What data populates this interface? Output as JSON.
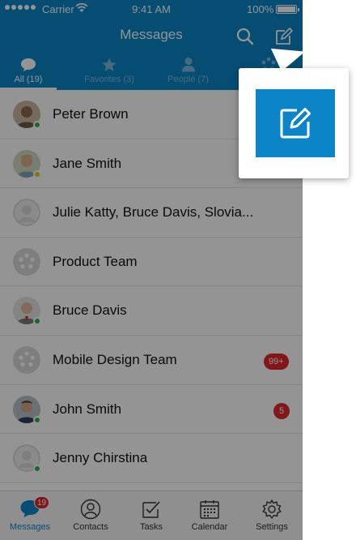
{
  "status_bar": {
    "carrier": "Carrier",
    "time": "9:41 AM",
    "battery": "100%"
  },
  "header": {
    "title": "Messages",
    "search_icon": "search-icon",
    "compose_icon": "compose-icon"
  },
  "tabs": [
    {
      "label": "All (19)",
      "icon": "chat-bubble-icon",
      "active": true
    },
    {
      "label": "Favorites (3)",
      "icon": "star-icon",
      "active": false
    },
    {
      "label": "People (7)",
      "icon": "person-icon",
      "active": false
    },
    {
      "label": "",
      "icon": "team-icon",
      "active": false
    }
  ],
  "conversations": [
    {
      "name": "Peter Brown",
      "avatar": "photo",
      "presence": "online",
      "badge": ""
    },
    {
      "name": "Jane Smith",
      "avatar": "photo",
      "presence": "away",
      "badge": ""
    },
    {
      "name": "Julie Katty, Bruce Davis, Slovia...",
      "avatar": "placeholder",
      "presence": "",
      "badge": ""
    },
    {
      "name": "Product Team",
      "avatar": "group",
      "presence": "",
      "badge": ""
    },
    {
      "name": "Bruce Davis",
      "avatar": "photo",
      "presence": "online",
      "badge": ""
    },
    {
      "name": "Mobile Design Team",
      "avatar": "group",
      "presence": "",
      "badge": "99+"
    },
    {
      "name": "John Smith",
      "avatar": "photo",
      "presence": "online",
      "badge": "5"
    },
    {
      "name": "Jenny Chirstina",
      "avatar": "placeholder",
      "presence": "online",
      "badge": ""
    }
  ],
  "bottom_tabs": [
    {
      "label": "Messages",
      "icon": "messages-icon",
      "active": true,
      "badge": "19"
    },
    {
      "label": "Contacts",
      "icon": "contacts-icon",
      "active": false,
      "badge": ""
    },
    {
      "label": "Tasks",
      "icon": "tasks-icon",
      "active": false,
      "badge": ""
    },
    {
      "label": "Calendar",
      "icon": "calendar-icon",
      "active": false,
      "badge": ""
    },
    {
      "label": "Settings",
      "icon": "settings-icon",
      "active": false,
      "badge": ""
    }
  ],
  "callout": {
    "icon": "compose-icon"
  },
  "colors": {
    "brand": "#0b85c8",
    "online": "#2cb34a",
    "away": "#f2c100",
    "badge": "#e0292b"
  }
}
